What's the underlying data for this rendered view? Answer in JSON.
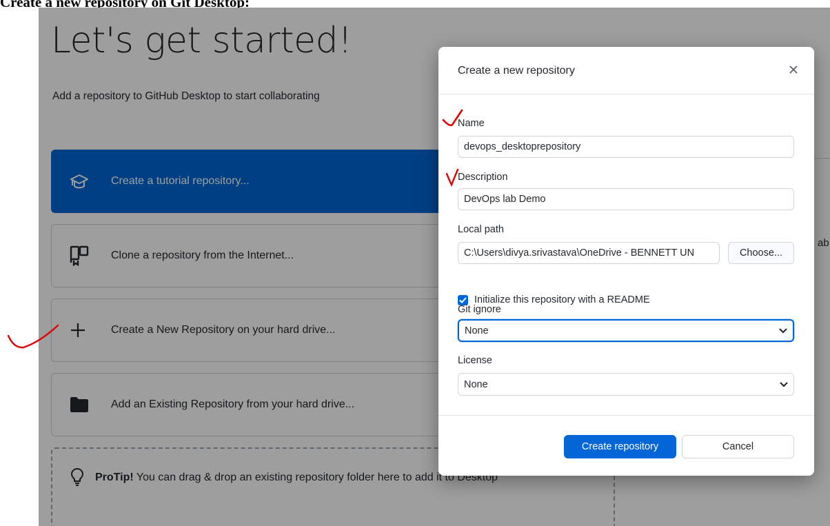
{
  "document_heading": "Create a new repository on Git Desktop:",
  "welcome": {
    "title": "Let's get started!",
    "subtitle": "Add a repository to GitHub Desktop to start collaborating",
    "options": [
      {
        "label": "Create a tutorial repository...",
        "icon": "graduation-cap-icon"
      },
      {
        "label": "Clone a repository from the Internet...",
        "icon": "repo-clone-icon"
      },
      {
        "label": "Create a New Repository on your hard drive...",
        "icon": "plus-icon"
      },
      {
        "label": "Add an Existing Repository from your hard drive...",
        "icon": "folder-icon"
      }
    ],
    "protip_strong": "ProTip!",
    "protip_text": " You can drag & drop an existing repository folder here to add it to Desktop",
    "right_fragment": "ab"
  },
  "dialog": {
    "title": "Create a new repository",
    "name_label": "Name",
    "name_value": "devops_desktoprepository",
    "description_label": "Description",
    "description_value": "DevOps lab Demo",
    "local_path_label": "Local path",
    "local_path_value": "C:\\Users\\divya.srivastava\\OneDrive - BENNETT UN",
    "choose_label": "Choose...",
    "readme_label": "Initialize this repository with a README",
    "readme_checked": true,
    "git_ignore_label": "Git ignore",
    "git_ignore_value": "None",
    "license_label": "License",
    "license_value": "None",
    "create_label": "Create repository",
    "cancel_label": "Cancel"
  },
  "colors": {
    "accent": "#0366d6",
    "annotation": "#e00000"
  }
}
